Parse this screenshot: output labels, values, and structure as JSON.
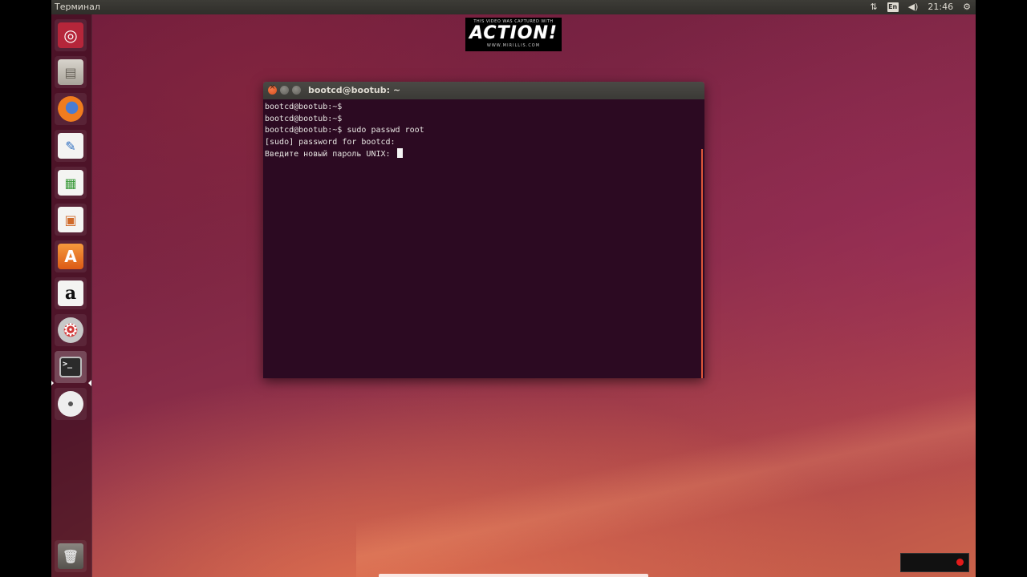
{
  "top_panel": {
    "app_title": "Терминал",
    "indicators": {
      "network": "⇅",
      "keyboard": "En",
      "volume": "◀)",
      "clock": "21:46",
      "settings": "⚙"
    }
  },
  "launcher": {
    "items": [
      {
        "name": "dash",
        "glyph": "◎"
      },
      {
        "name": "files",
        "glyph": "▤"
      },
      {
        "name": "firefox",
        "glyph": "●"
      },
      {
        "name": "writer",
        "glyph": "✎"
      },
      {
        "name": "calc",
        "glyph": "▦"
      },
      {
        "name": "impress",
        "glyph": "▣"
      },
      {
        "name": "software-center",
        "glyph": "A"
      },
      {
        "name": "amazon",
        "glyph": "a"
      },
      {
        "name": "system-settings",
        "glyph": "⚙"
      },
      {
        "name": "terminal",
        "glyph": ">_"
      },
      {
        "name": "dvd",
        "glyph": "◉"
      },
      {
        "name": "trash",
        "glyph": "🗑"
      }
    ]
  },
  "watermark": {
    "top": "THIS VIDEO WAS CAPTURED WITH",
    "main": "ACTION!",
    "bottom": "WWW.MIRILLIS.COM"
  },
  "terminal": {
    "title": "bootcd@bootub: ~",
    "lines": [
      "bootcd@bootub:~$",
      "bootcd@bootub:~$",
      "bootcd@bootub:~$ sudo passwd root",
      "[sudo] password for bootcd:",
      "Введите новый пароль UNIX: "
    ]
  },
  "colors": {
    "accent": "#e0583a",
    "terminal_bg": "#2c0a22",
    "panel_bg": "#3b3a36"
  }
}
